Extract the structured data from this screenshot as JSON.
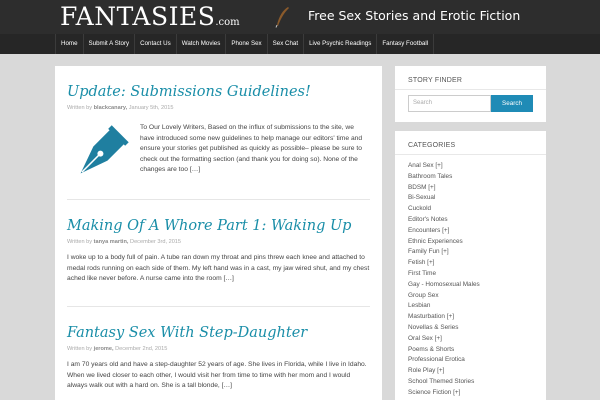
{
  "header": {
    "logo_main": "FANTASIES",
    "logo_suffix": ".com",
    "tagline": "Free Sex Stories and Erotic Fiction"
  },
  "nav": {
    "items": [
      "Home",
      "Submit A Story",
      "Contact Us",
      "Watch Movies",
      "Phone Sex",
      "Sex Chat",
      "Live Psychic Readings",
      "Fantasy Football"
    ]
  },
  "posts": [
    {
      "title": "Update: Submissions Guidelines!",
      "meta_prefix": "Written by",
      "author": "blackcanary,",
      "date": "January 5th, 2015",
      "excerpt": "To Our Lovely Writers, Based on the influx of submissions to the site, we have introduced some new guidelines to help manage our editors' time and ensure your stories get published as quickly as possible– please be sure to check out the formatting section (and thank you for doing so). None of the changes are too […]"
    },
    {
      "title": "Making Of A Whore Part 1: Waking Up",
      "meta_prefix": "Written by",
      "author": "tanya martin,",
      "date": "December 3rd, 2015",
      "excerpt": "I woke up to a body full of pain. A tube ran down my throat and pins threw each knee and attached to medal rods running on each side of them. My left hand was in a cast, my jaw wired shut, and my chest ached like never before. A nurse came into the room […]"
    },
    {
      "title": "Fantasy Sex With Step-Daughter",
      "meta_prefix": "Written by",
      "author": "jerome,",
      "date": "December 2nd, 2015",
      "excerpt": "I am 70 years old and have a step-daughter 52 years of age.  She lives in Florida, while I live in Idaho.  When we lived closer to each other, I would visit her from time to time with her mom and I would always walk out with a hard on.  She is a tall blonde, […]"
    }
  ],
  "sidebar": {
    "story_finder": {
      "title": "STORY FINDER",
      "search_placeholder": "Search",
      "search_button": "Search"
    },
    "categories": {
      "title": "CATEGORIES",
      "items": [
        "Anal Sex [+]",
        "Bathroom Tales",
        "BDSM [+]",
        "Bi-Sexual",
        "Cuckold",
        "Editor's Notes",
        "Encounters [+]",
        "Ethnic Experiences",
        "Family Fun [+]",
        "Fetish [+]",
        "First Time",
        "Gay - Homosexual Males",
        "Group Sex",
        "Lesbian",
        "Masturbation [+]",
        "Novellas & Series",
        "Oral Sex [+]",
        "Poems & Shorts",
        "Professional Erotica",
        "Role Play [+]",
        "School Themed Stories",
        "Science Fiction [+]"
      ]
    }
  },
  "colors": {
    "header_bg": "#2d2d2d",
    "nav_bg": "#262626",
    "page_bg": "#d9d9d9",
    "title_blue": "#1a8ea8",
    "button_blue": "#1f8bb6"
  }
}
